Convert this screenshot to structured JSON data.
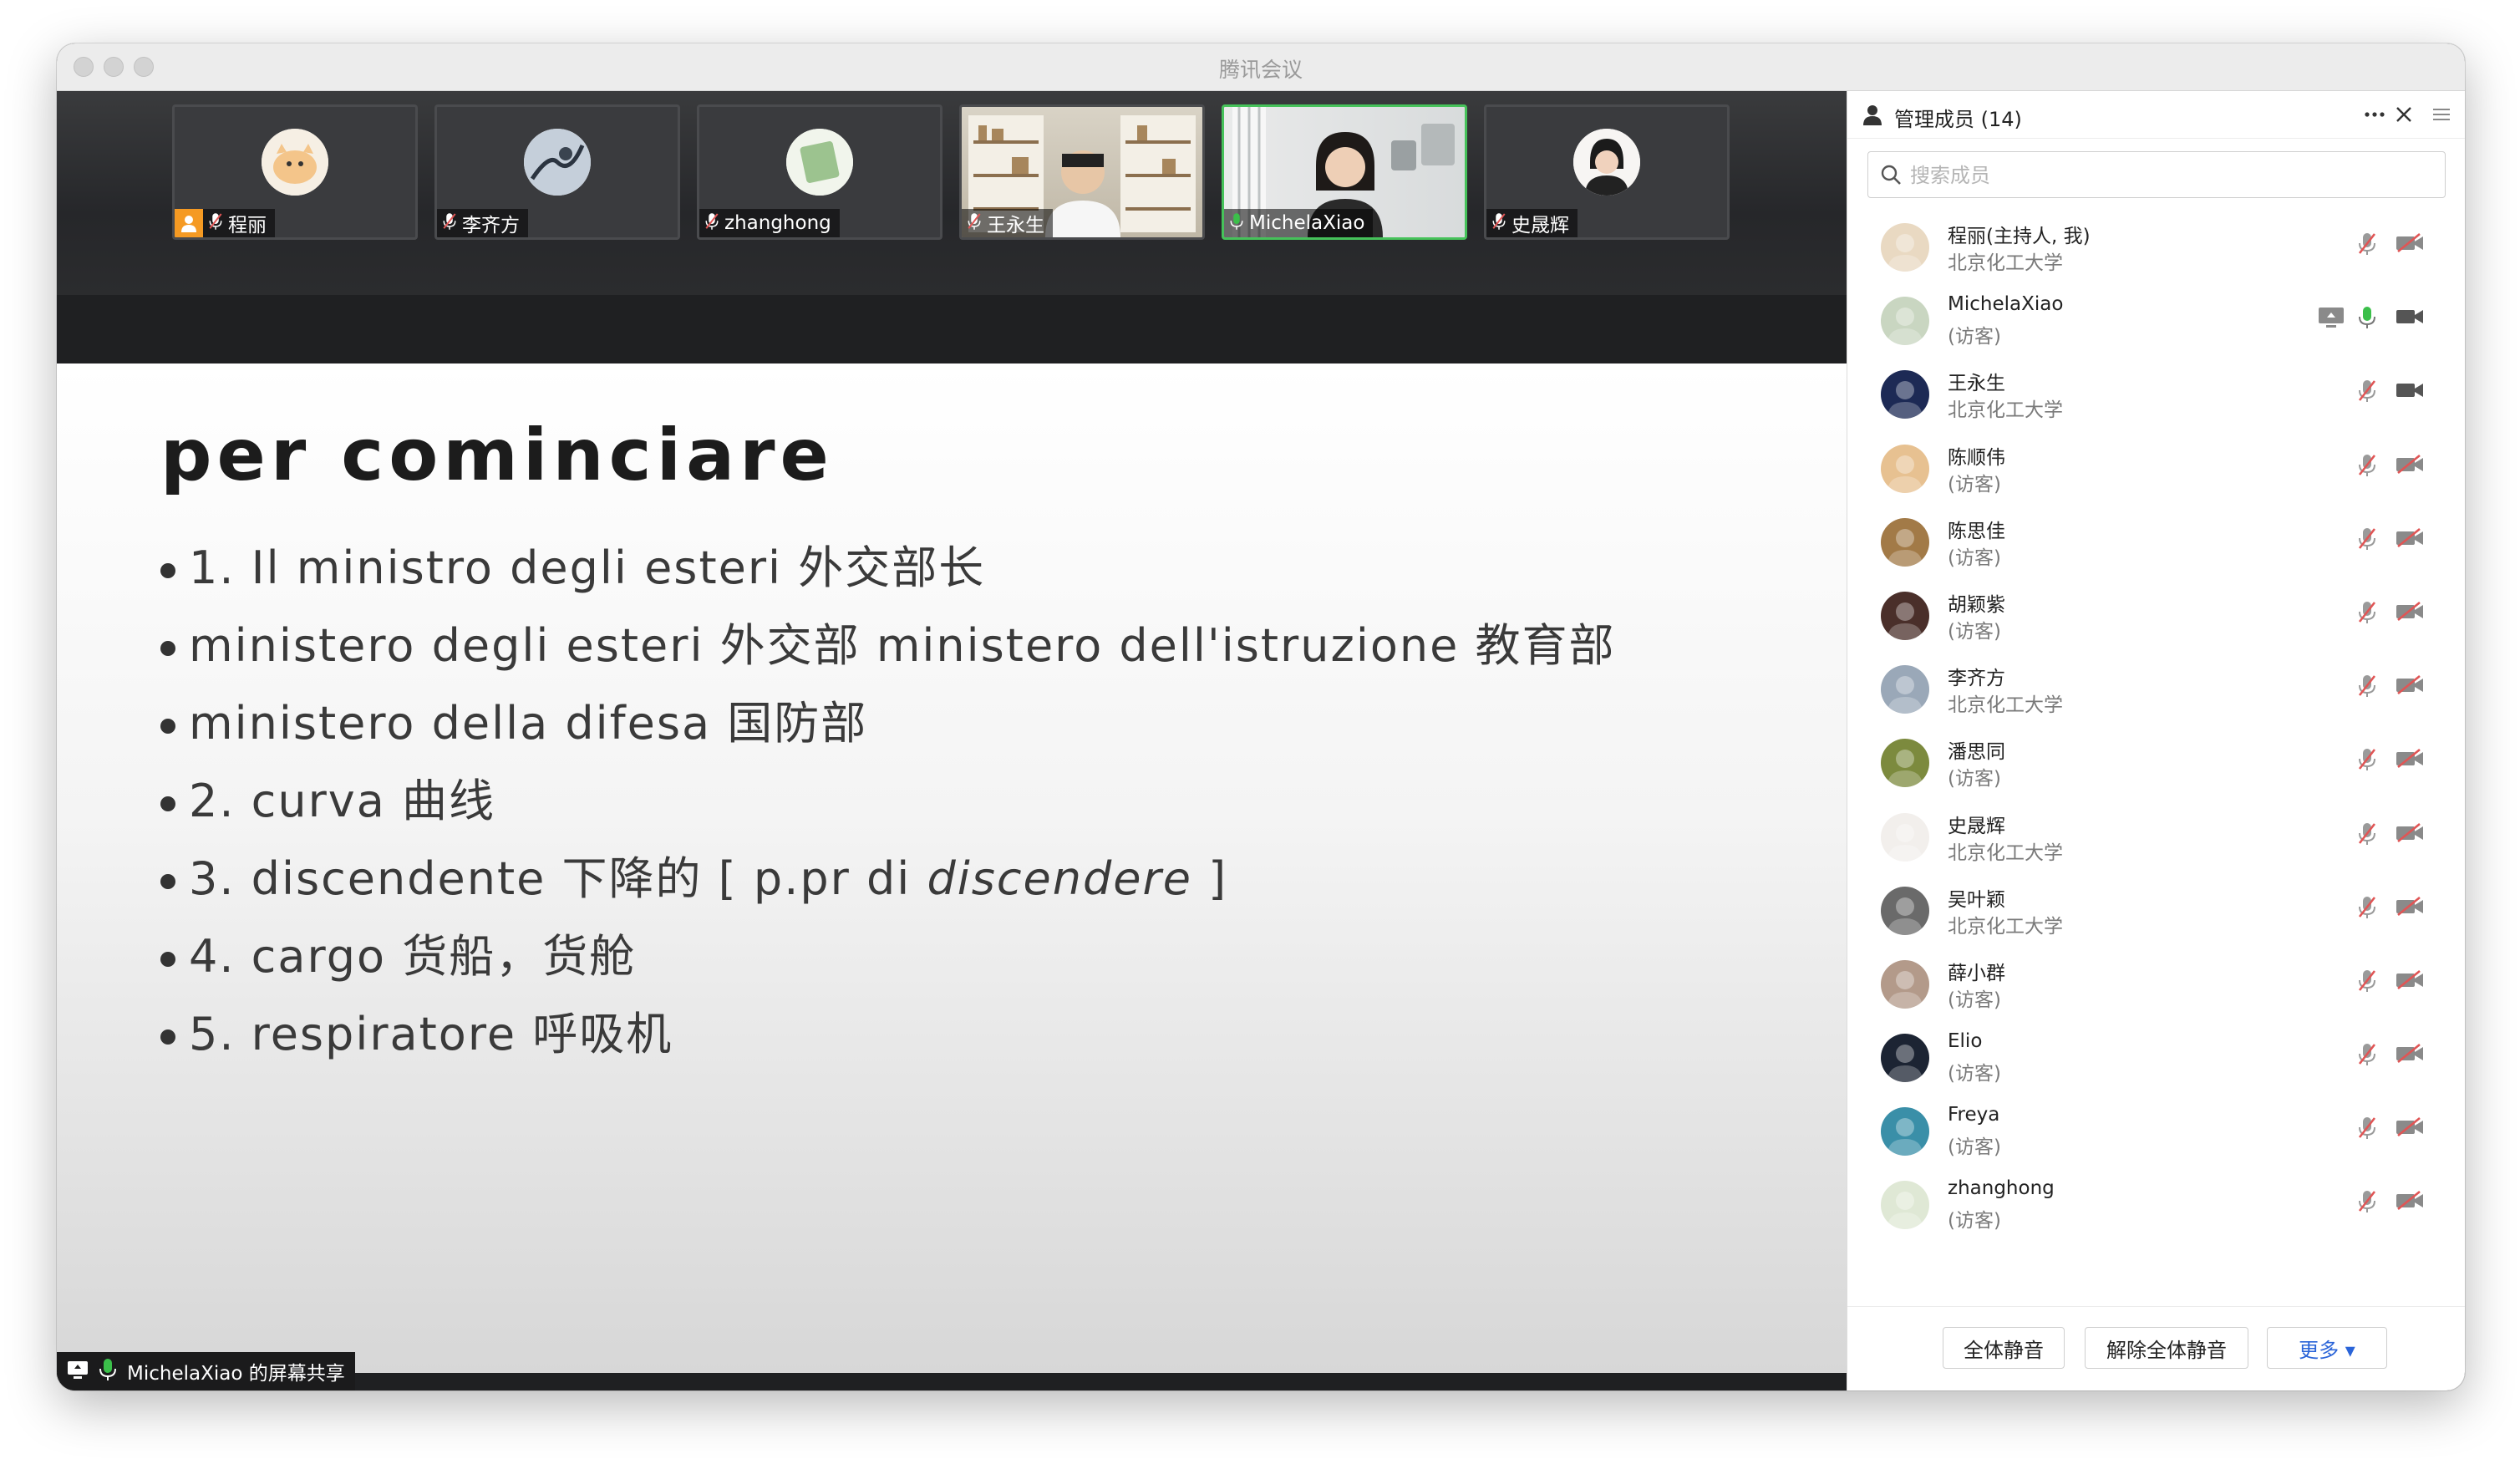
{
  "window": {
    "title": "腾讯会议"
  },
  "thumbnails": [
    {
      "name": "程丽",
      "host": true,
      "muted": true,
      "active": false,
      "avatar": "cat-cartoon"
    },
    {
      "name": "李齐方",
      "host": false,
      "muted": true,
      "active": false,
      "avatar": "ink-painting"
    },
    {
      "name": "zhanghong",
      "host": false,
      "muted": true,
      "active": false,
      "avatar": "sticker"
    },
    {
      "name": "王永生",
      "host": false,
      "muted": true,
      "active": false,
      "avatar": "video-bookshelf"
    },
    {
      "name": "MichelaXiao",
      "host": false,
      "muted": false,
      "active": true,
      "avatar": "video-woman"
    },
    {
      "name": "史晟辉",
      "host": false,
      "muted": true,
      "active": false,
      "avatar": "portrait"
    }
  ],
  "slide": {
    "title": "per cominciare",
    "bullets": [
      {
        "text": "1. Il ministro degli esteri  外交部长"
      },
      {
        "text": "ministero degli esteri 外交部  ministero dell'istruzione 教育部"
      },
      {
        "text": "ministero della difesa 国防部"
      },
      {
        "text": "2. curva 曲线"
      },
      {
        "text": "3. discendente 下降的 [ p.pr di ",
        "italic": "discendere",
        "after": " ]"
      },
      {
        "text": "4. cargo 货船，货舱"
      },
      {
        "text": "5. respiratore 呼吸机"
      }
    ]
  },
  "sharebar": {
    "text": "MichelaXiao 的屏幕共享"
  },
  "panel": {
    "title": "管理成员 (14)",
    "search_placeholder": "搜索成员",
    "members": [
      {
        "name": "程丽(主持人, 我)",
        "sub": "北京化工大学",
        "mic": "muted",
        "cam": "off",
        "screen": false,
        "avatar_color": "#e9d9c2"
      },
      {
        "name": "MichelaXiao",
        "sub": "(访客)",
        "mic": "on",
        "cam": "on",
        "screen": true,
        "avatar_color": "#c9d6c1"
      },
      {
        "name": "王永生",
        "sub": "北京化工大学",
        "mic": "muted",
        "cam": "on",
        "screen": false,
        "avatar_color": "#1d2a55"
      },
      {
        "name": "陈顺伟",
        "sub": "(访客)",
        "mic": "muted",
        "cam": "off",
        "screen": false,
        "avatar_color": "#e7c191"
      },
      {
        "name": "陈思佳",
        "sub": "(访客)",
        "mic": "muted",
        "cam": "off",
        "screen": false,
        "avatar_color": "#a27a47"
      },
      {
        "name": "胡颖紫",
        "sub": "(访客)",
        "mic": "muted",
        "cam": "off",
        "screen": false,
        "avatar_color": "#4a2f2a"
      },
      {
        "name": "李齐方",
        "sub": "北京化工大学",
        "mic": "muted",
        "cam": "off",
        "screen": false,
        "avatar_color": "#9aa8b8"
      },
      {
        "name": "潘思同",
        "sub": "(访客)",
        "mic": "muted",
        "cam": "off",
        "screen": false,
        "avatar_color": "#7c8a3e"
      },
      {
        "name": "史晟辉",
        "sub": "北京化工大学",
        "mic": "muted",
        "cam": "off",
        "screen": false,
        "avatar_color": "#f2efec"
      },
      {
        "name": "吴叶颖",
        "sub": "北京化工大学",
        "mic": "muted",
        "cam": "off",
        "screen": false,
        "avatar_color": "#6a6a6a"
      },
      {
        "name": "薛小群",
        "sub": "(访客)",
        "mic": "muted",
        "cam": "off",
        "screen": false,
        "avatar_color": "#b39a8a"
      },
      {
        "name": "Elio",
        "sub": "(访客)",
        "mic": "muted",
        "cam": "off",
        "screen": false,
        "avatar_color": "#1c2433"
      },
      {
        "name": "Freya",
        "sub": "(访客)",
        "mic": "muted",
        "cam": "off",
        "screen": false,
        "avatar_color": "#3a8fa8"
      },
      {
        "name": "zhanghong",
        "sub": "(访客)",
        "mic": "muted",
        "cam": "off",
        "screen": false,
        "avatar_color": "#dfe8d5"
      }
    ],
    "buttons": {
      "mute_all": "全体静音",
      "unmute_all": "解除全体静音",
      "more": "更多 ▾"
    }
  },
  "colors": {
    "active_border": "#46c25a",
    "host_badge": "#f59a23",
    "muted_red": "#e05555",
    "mic_green": "#3bbf4a",
    "link_blue": "#2a64d8"
  }
}
